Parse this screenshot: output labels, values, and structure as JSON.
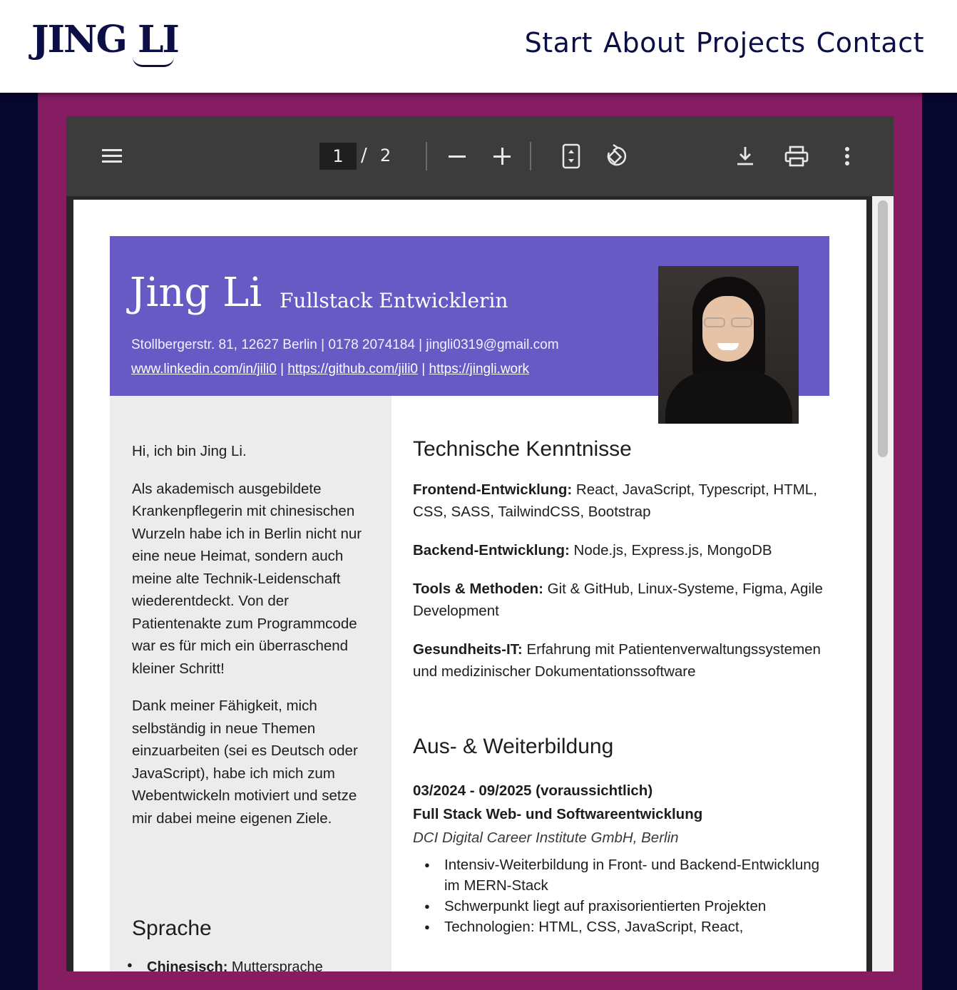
{
  "header": {
    "logo": "JING LI",
    "nav": [
      "Start",
      "About",
      "Projects",
      "Contact"
    ]
  },
  "viewer": {
    "current_page": "1",
    "page_separator": "/",
    "total_pages": "2",
    "icons": [
      "menu-icon",
      "zoom-out-icon",
      "zoom-in-icon",
      "fit-page-icon",
      "rotate-icon",
      "download-icon",
      "print-icon",
      "more-options-icon"
    ]
  },
  "cv": {
    "name": "Jing Li",
    "role": "Fullstack Entwicklerin",
    "contact": "Stollbergerstr. 81, 12627 Berlin | 0178 2074184 | jingli0319@gmail.com",
    "links": [
      "www.linkedin.com/in/jili0",
      "https://github.com/jili0",
      "https://jingli.work"
    ],
    "link_separator": "|",
    "sidebar": {
      "intro": [
        "Hi, ich bin Jing Li.",
        "Als akademisch ausgebildete Krankenpflegerin mit chinesischen Wurzeln habe ich in Berlin nicht nur eine neue Heimat, sondern auch meine alte Technik-Leidenschaft wiederentdeckt. Von der Patientenakte zum Programmcode war es für mich ein überraschend kleiner Schritt!",
        "Dank meiner Fähigkeit, mich selbständig in neue Themen einzuarbeiten (sei es Deutsch oder JavaScript), habe ich mich zum Webentwickeln motiviert und setze mir dabei meine eigenen Ziele."
      ],
      "language_heading": "Sprache",
      "language_item_label": "Chinesisch:",
      "language_item_value": "Muttersprache"
    },
    "skills_heading": "Technische Kenntnisse",
    "skills": [
      {
        "label": "Frontend-Entwicklung:",
        "value": "React, JavaScript, Typescript, HTML, CSS, SASS, TailwindCSS, Bootstrap"
      },
      {
        "label": "Backend-Entwicklung:",
        "value": "Node.js, Express.js, MongoDB"
      },
      {
        "label": "Tools & Methoden:",
        "value": "Git & GitHub, Linux-Systeme, Figma, Agile Development"
      },
      {
        "label": "Gesundheits-IT:",
        "value": "Erfahrung mit Patientenverwaltungssystemen und medizinischer Dokumentationssoftware"
      }
    ],
    "education_heading": "Aus- & Weiterbildung",
    "education": {
      "date": "03/2024 - 09/2025 (voraussichtlich)",
      "title": "Full Stack Web- und Softwareentwicklung",
      "institution": "DCI Digital Career Institute GmbH, Berlin",
      "bullets": [
        "Intensiv-Weiterbildung in Front- und Backend-Entwicklung im MERN-Stack",
        "Schwerpunkt liegt auf praxisorientierten Projekten",
        "Technologien: HTML, CSS, JavaScript, React,"
      ]
    }
  }
}
